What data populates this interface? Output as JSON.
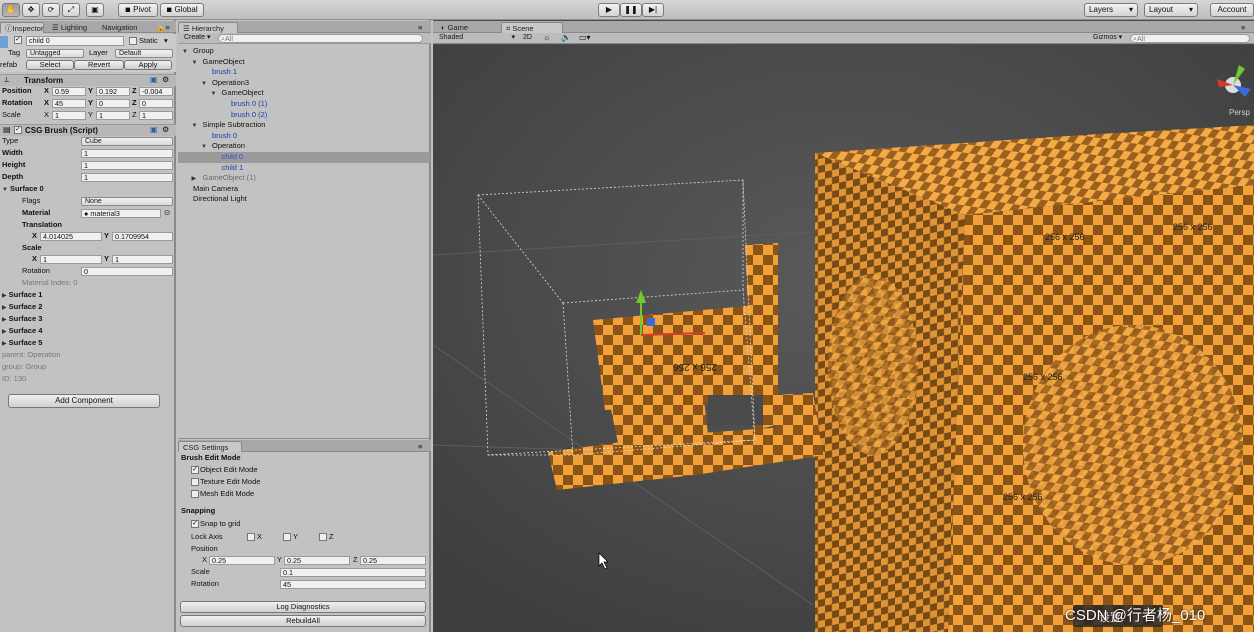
{
  "toolbar": {
    "pivot_label": "Pivot",
    "global_label": "Global",
    "layers_label": "Layers",
    "layout_label": "Layout",
    "account_label": "Account"
  },
  "inspector": {
    "tabs": [
      "Inspector",
      "Lighting",
      "Navigation"
    ],
    "object_name": "child 0",
    "static_label": "Static",
    "tag_label": "Tag",
    "tag_value": "Untagged",
    "layer_label": "Layer",
    "layer_value": "Default",
    "prefab_label": "refab",
    "select_label": "Select",
    "revert_label": "Revert",
    "apply_label": "Apply",
    "transform": {
      "title": "Transform",
      "position_label": "Position",
      "rotation_label": "Rotation",
      "scale_label": "Scale",
      "position": [
        "0.59",
        "0.192",
        "-0.004"
      ],
      "rotation": [
        "45",
        "0",
        "0"
      ],
      "scale": [
        "1",
        "1",
        "1"
      ]
    },
    "csg": {
      "title": "CSG Brush (Script)",
      "type_label": "Type",
      "type_value": "Cube",
      "width_label": "Width",
      "width_value": "1",
      "height_label": "Height",
      "height_value": "1",
      "depth_label": "Depth",
      "depth_value": "1",
      "surface0_label": "Surface 0",
      "flags_label": "Flags",
      "flags_value": "None",
      "material_label": "Material",
      "material_value": "material3",
      "translation_label": "Translation",
      "translation_x": "4.014025",
      "translation_y": "0.1709954",
      "scale_label": "Scale",
      "scale_x": "1",
      "scale_y": "1",
      "rotation_label": "Rotation",
      "rotation_value": "0",
      "material_index": "Material Index: 0",
      "surfaces": [
        "Surface 1",
        "Surface 2",
        "Surface 3",
        "Surface 4",
        "Surface 5"
      ],
      "parent": "parent: Operation",
      "group": "group: Group",
      "id": "ID: 130"
    },
    "add_component": "Add Component"
  },
  "hierarchy": {
    "tab": "Hierarchy",
    "create": "Create",
    "search_placeholder": "All",
    "items": [
      {
        "label": "Group",
        "indent": 0,
        "arrow": "▼",
        "color": "black",
        "selected": false
      },
      {
        "label": "GameObject",
        "indent": 1,
        "arrow": "▼",
        "color": "black",
        "selected": false
      },
      {
        "label": "brush 1",
        "indent": 2,
        "arrow": "",
        "color": "blue",
        "selected": false
      },
      {
        "label": "Operation3",
        "indent": 2,
        "arrow": "▼",
        "color": "black",
        "selected": false
      },
      {
        "label": "GameObject",
        "indent": 3,
        "arrow": "▼",
        "color": "black",
        "selected": false
      },
      {
        "label": "brush 0 (1)",
        "indent": 4,
        "arrow": "",
        "color": "blue",
        "selected": false
      },
      {
        "label": "brush 0 (2)",
        "indent": 4,
        "arrow": "",
        "color": "blue",
        "selected": false
      },
      {
        "label": "Simple Subtraction",
        "indent": 1,
        "arrow": "▼",
        "color": "black",
        "selected": false
      },
      {
        "label": "brush 0",
        "indent": 2,
        "arrow": "",
        "color": "blue",
        "selected": false
      },
      {
        "label": "Operation",
        "indent": 2,
        "arrow": "▼",
        "color": "black",
        "selected": false
      },
      {
        "label": "child 0",
        "indent": 3,
        "arrow": "",
        "color": "blue",
        "selected": true
      },
      {
        "label": "child 1",
        "indent": 3,
        "arrow": "",
        "color": "blue",
        "selected": false
      },
      {
        "label": "GameObject (1)",
        "indent": 1,
        "arrow": "▶",
        "color": "gray",
        "selected": false
      },
      {
        "label": "Main Camera",
        "indent": 0,
        "arrow": "",
        "color": "black",
        "selected": false
      },
      {
        "label": "Directional Light",
        "indent": 0,
        "arrow": "",
        "color": "black",
        "selected": false
      }
    ]
  },
  "csg_settings": {
    "tab": "CSG Settings",
    "brush_edit_mode": "Brush Edit Mode",
    "object_edit_mode": "Object Edit Mode",
    "texture_edit_mode": "Texture Edit Mode",
    "mesh_edit_mode": "Mesh Edit Mode",
    "snapping": "Snapping",
    "snap_to_grid": "Snap to grid",
    "lock_axis": "Lock Axis",
    "axes": [
      "X",
      "Y",
      "Z"
    ],
    "position_label": "Position",
    "position": [
      "0.25",
      "0.25",
      "0.25"
    ],
    "scale_label": "Scale",
    "scale_value": "0.1",
    "rotation_label": "Rotation",
    "rotation_value": "45",
    "log_diagnostics": "Log Diagnostics",
    "rebuild_all": "RebuildAll"
  },
  "scene": {
    "tabs": [
      "Game",
      "Scene"
    ],
    "shaded": "Shaded",
    "mode_2d": "2D",
    "gizmos": "Gizmos",
    "search_placeholder": "All",
    "persp": "Persp",
    "texture_labels": [
      "256 x 256",
      "256 x 256",
      "256 x 256",
      "256 x 256",
      "256 x 256"
    ]
  },
  "watermark": "CSDN @行者杨_010",
  "overlay_button": "设置"
}
